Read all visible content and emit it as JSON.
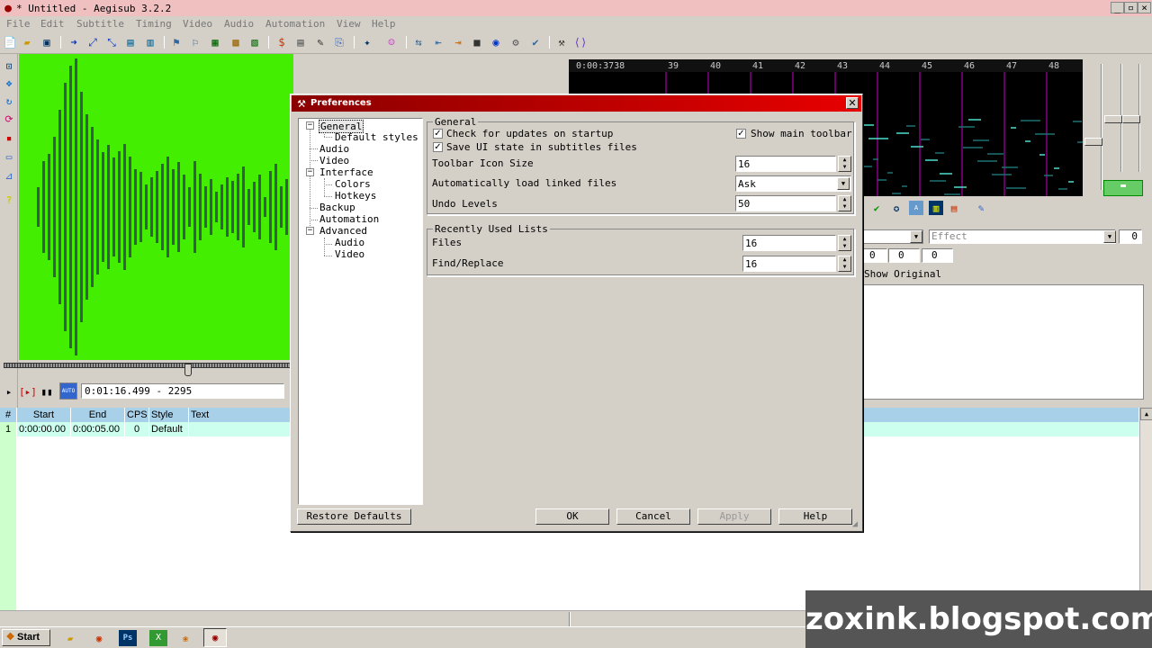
{
  "window": {
    "title": "* Untitled - Aegisub 3.2.2",
    "controls": [
      "_",
      "8",
      "x"
    ]
  },
  "menu": [
    "File",
    "Edit",
    "Subtitle",
    "Timing",
    "Video",
    "Audio",
    "Automation",
    "View",
    "Help"
  ],
  "video": {
    "time_display": "0:01:16.499 - 2295",
    "auto_label": "AUTO"
  },
  "audio": {
    "timeline_start": "0:00:3738",
    "ticks": [
      "39",
      "40",
      "41",
      "42",
      "43",
      "44",
      "45",
      "46",
      "47",
      "48"
    ]
  },
  "edit_box": {
    "effect_placeholder": "Effect",
    "layer": "0",
    "margins": [
      "0",
      "0",
      "0"
    ],
    "show_original": "Show Original"
  },
  "grid": {
    "headers": [
      "#",
      "Start",
      "End",
      "CPS",
      "Style",
      "Text"
    ],
    "rows": [
      {
        "num": "1",
        "start": "0:00:00.00",
        "end": "0:00:05.00",
        "cps": "0",
        "style": "Default",
        "text": ""
      }
    ]
  },
  "taskbar": {
    "start_label": "Start"
  },
  "watermark": "zoxink.blogspot.com",
  "dialog": {
    "title": "Preferences",
    "tree": {
      "general": "General",
      "default_styles": "Default styles",
      "audio": "Audio",
      "video": "Video",
      "interface": "Interface",
      "colors": "Colors",
      "hotkeys": "Hotkeys",
      "backup": "Backup",
      "automation": "Automation",
      "advanced": "Advanced",
      "adv_audio": "Audio",
      "adv_video": "Video"
    },
    "general_group": {
      "label": "General",
      "check_updates": "Check for updates on startup",
      "check_updates_checked": true,
      "show_toolbar": "Show main toolbar",
      "show_toolbar_checked": true,
      "save_ui": "Save UI state in subtitles files",
      "save_ui_checked": true,
      "icon_size_label": "Toolbar Icon Size",
      "icon_size_value": "16",
      "autoload_label": "Automatically load linked files",
      "autoload_value": "Ask",
      "undo_label": "Undo Levels",
      "undo_value": "50"
    },
    "recent_group": {
      "label": "Recently Used Lists",
      "files_label": "Files",
      "files_value": "16",
      "find_label": "Find/Replace",
      "find_value": "16"
    },
    "buttons": {
      "restore": "Restore Defaults",
      "ok": "OK",
      "cancel": "Cancel",
      "apply": "Apply",
      "help": "Help"
    }
  }
}
